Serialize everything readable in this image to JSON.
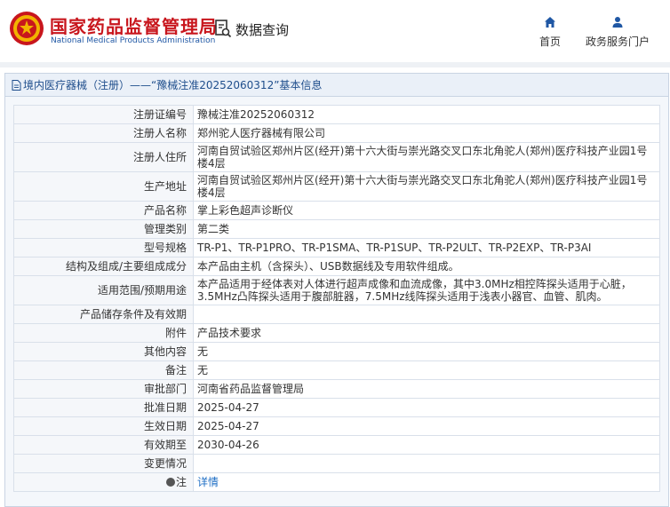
{
  "header": {
    "brand_cn": "国家药品监督管理局",
    "brand_en": "National Medical Products Administration",
    "search_label": "数据查询",
    "nav": [
      {
        "label": "首页",
        "icon": "home-icon"
      },
      {
        "label": "政务服务门户",
        "icon": "user-icon"
      }
    ]
  },
  "panel": {
    "title": "境内医疗器械（注册）——“豫械注准20252060312”基本信息"
  },
  "rows": [
    {
      "label": "注册证编号",
      "value": "豫械注准20252060312"
    },
    {
      "label": "注册人名称",
      "value": "郑州驼人医疗器械有限公司"
    },
    {
      "label": "注册人住所",
      "value": "河南自贸试验区郑州片区(经开)第十六大街与崇光路交叉口东北角驼人(郑州)医疗科技产业园1号楼4层"
    },
    {
      "label": "生产地址",
      "value": "河南自贸试验区郑州片区(经开)第十六大街与崇光路交叉口东北角驼人(郑州)医疗科技产业园1号楼4层"
    },
    {
      "label": "产品名称",
      "value": "掌上彩色超声诊断仪"
    },
    {
      "label": "管理类别",
      "value": "第二类"
    },
    {
      "label": "型号规格",
      "value": "TR-P1、TR-P1PRO、TR-P1SMA、TR-P1SUP、TR-P2ULT、TR-P2EXP、TR-P3AI"
    },
    {
      "label": "结构及组成/主要组成成分",
      "value": "本产品由主机（含探头）、USB数据线及专用软件组成。"
    },
    {
      "label": "适用范围/预期用途",
      "value": "本产品适用于经体表对人体进行超声成像和血流成像，其中3.0MHz相控阵探头适用于心脏，3.5MHz凸阵探头适用于腹部脏器，7.5MHz线阵探头适用于浅表小器官、血管、肌肉。"
    },
    {
      "label": "产品储存条件及有效期",
      "value": ""
    },
    {
      "label": "附件",
      "value": "产品技术要求"
    },
    {
      "label": "其他内容",
      "value": "无"
    },
    {
      "label": "备注",
      "value": "无"
    },
    {
      "label": "审批部门",
      "value": "河南省药品监督管理局"
    },
    {
      "label": "批准日期",
      "value": "2025-04-27"
    },
    {
      "label": "生效日期",
      "value": "2025-04-27"
    },
    {
      "label": "有效期至",
      "value": "2030-04-26"
    },
    {
      "label": "变更情况",
      "value": ""
    }
  ],
  "note": {
    "label": "注",
    "link": "详情"
  },
  "colors": {
    "brand_red": "#c8161d",
    "brand_blue": "#1f57a4",
    "link_blue": "#1f6fc5",
    "logo_gold": "#f2b300"
  }
}
